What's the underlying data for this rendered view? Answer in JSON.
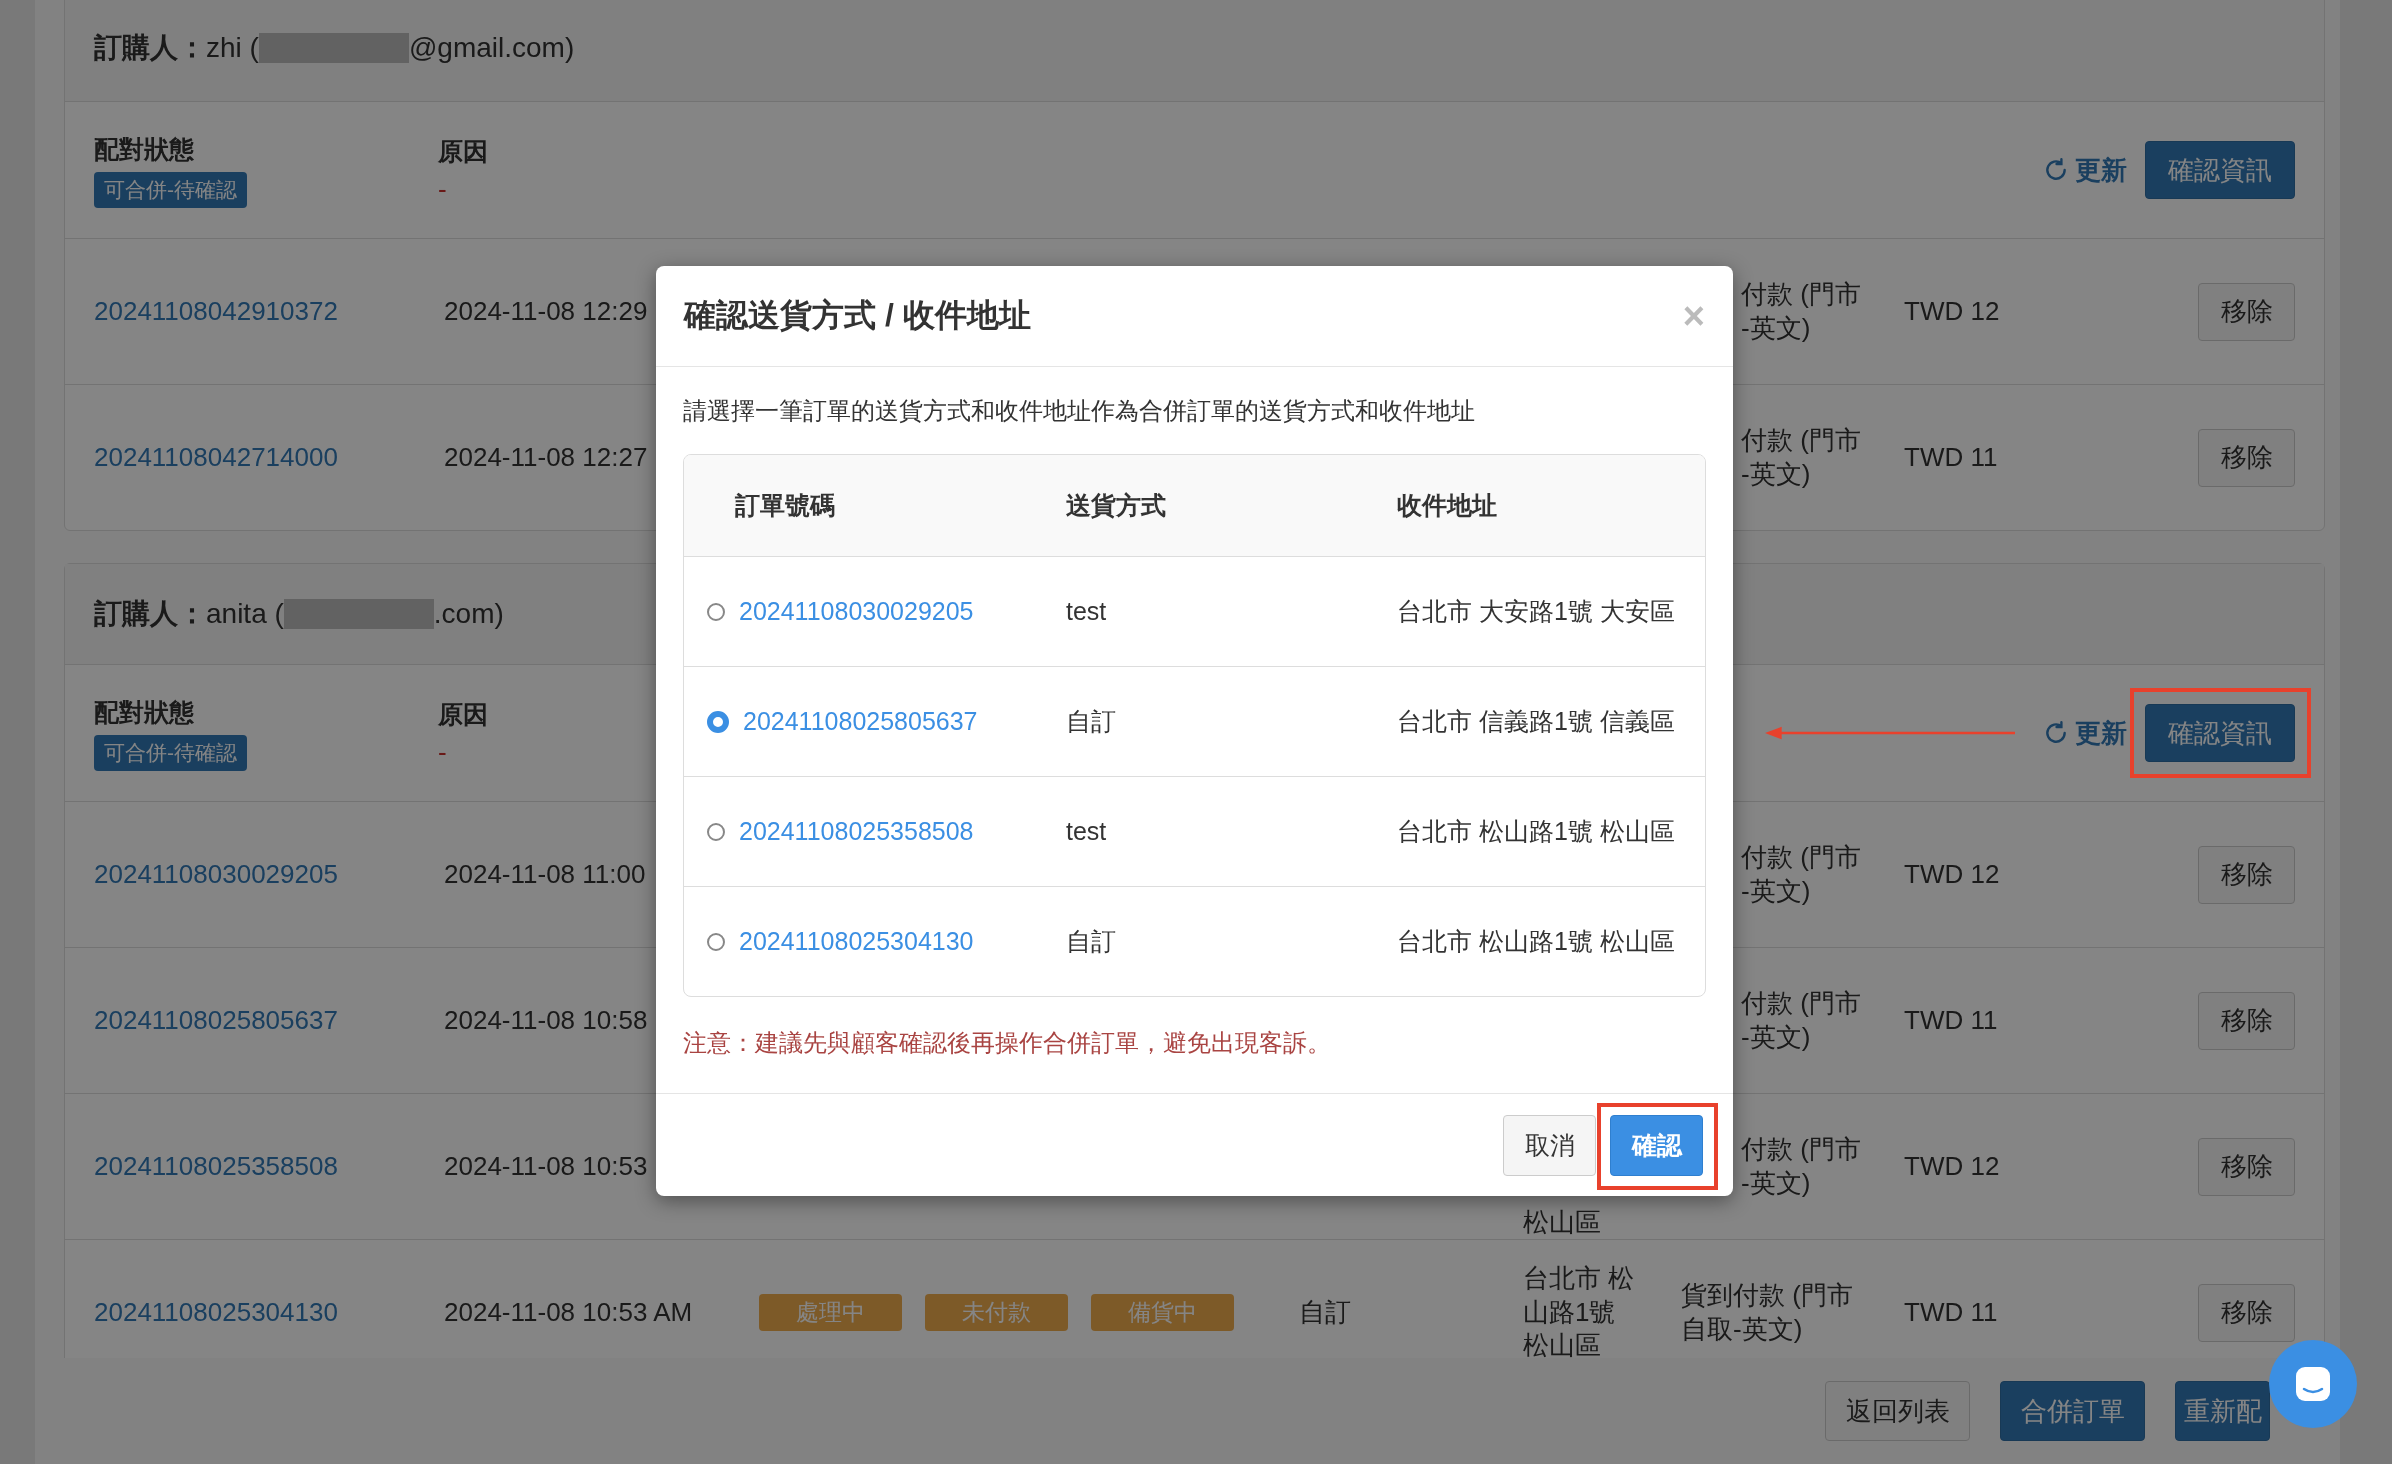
{
  "groups": [
    {
      "buyer_prefix": "**訂購人：**zhi (",
      "buyer_suffix": "@gmail.com)",
      "status_label": "配對狀態",
      "status": "可合併-待確認",
      "reason_label": "原因",
      "reason": "-",
      "refresh": "更新",
      "confirm": "確認資訊",
      "highlighted": false,
      "rows": [
        {
          "order": "20241108042910372",
          "date": "2024-11-08 12:29",
          "payment": "付款 (門市\n-英文)",
          "amount": "TWD 12",
          "remove": "移除"
        },
        {
          "order": "20241108042714000",
          "date": "2024-11-08 12:27",
          "payment": "付款 (門市\n-英文)",
          "amount": "TWD 11",
          "remove": "移除"
        }
      ]
    },
    {
      "buyer_prefix": "**訂購人：**anita (",
      "buyer_suffix": ".com)",
      "status_label": "配對狀態",
      "status": "可合併-待確認",
      "reason_label": "原因",
      "reason": "-",
      "refresh": "更新",
      "confirm": "確認資訊",
      "highlighted": true,
      "rows": [
        {
          "order": "20241108030029205",
          "date": "2024-11-08 11:00",
          "payment": "付款 (門市\n-英文)",
          "amount": "TWD 12",
          "remove": "移除"
        },
        {
          "order": "20241108025805637",
          "date": "2024-11-08 10:58",
          "payment": "付款 (門市\n-英文)",
          "amount": "TWD 11",
          "remove": "移除"
        },
        {
          "order": "20241108025358508",
          "date": "2024-11-08 10:53",
          "address": "松山區",
          "payment": "付款 (門市\n-英文)",
          "amount": "TWD 12",
          "remove": "移除"
        },
        {
          "order": "20241108025304130",
          "date": "2024-11-08 10:53 AM",
          "tags": [
            "處理中",
            "未付款",
            "備貨中"
          ],
          "shipping": "自訂",
          "address": "台北市 松山路1號松山區",
          "payment": "貨到付款 (門市自取-英文)",
          "amount": "TWD 11",
          "remove": "移除"
        }
      ]
    }
  ],
  "footer_buttons": [
    {
      "label": "返回列表",
      "kind": "default"
    },
    {
      "label": "合併訂單",
      "kind": "primary"
    },
    {
      "label": "重新配",
      "kind": "primary"
    }
  ],
  "modal": {
    "title": "確認送貨方式 / 收件地址",
    "close": "×",
    "instruction": "請選擇一筆訂單的送貨方式和收件地址作為合併訂單的送貨方式和收件地址",
    "columns": [
      "訂單號碼",
      "送貨方式",
      "收件地址"
    ],
    "rows": [
      {
        "selected": false,
        "order": "20241108030029205",
        "shipping": "test",
        "address": "台北市 大安路1號 大安區"
      },
      {
        "selected": true,
        "order": "20241108025805637",
        "shipping": "自訂",
        "address": "台北市 信義路1號 信義區"
      },
      {
        "selected": false,
        "order": "20241108025358508",
        "shipping": "test",
        "address": "台北市 松山路1號 松山區"
      },
      {
        "selected": false,
        "order": "20241108025304130",
        "shipping": "自訂",
        "address": "台北市 松山路1號 松山區"
      }
    ],
    "note": "注意：建議先與顧客確認後再操作合併訂單，避免出現客訴。",
    "cancel": "取消",
    "confirm": "確認",
    "confirm_highlighted": true
  }
}
